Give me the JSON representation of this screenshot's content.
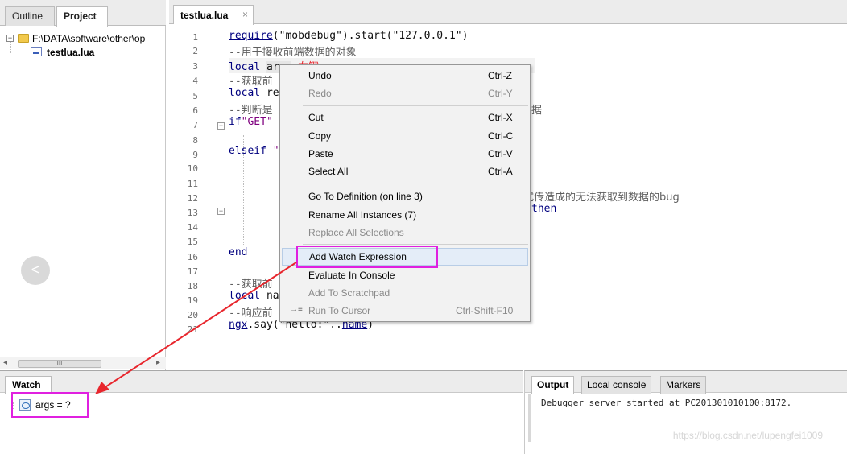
{
  "left_panel": {
    "tabs": [
      {
        "label": "Outline"
      },
      {
        "label": "Project"
      }
    ],
    "tree": {
      "root_label": "F:\\DATA\\software\\other\\op",
      "expander_glyph": "−",
      "file_label": "testlua.lua"
    },
    "scrollbar_thumb": "III"
  },
  "nav_circle_glyph": "<",
  "editor": {
    "tab_label": "testlua.lua",
    "tab_close": "×",
    "lines": {
      "1": {
        "prefix": "",
        "call": "require",
        "args": "(\"mobdebug\").start(\"127.0.0.1\")"
      },
      "2": {
        "comment": "--用于接收前端数据的对象"
      },
      "3": {
        "kw": "local",
        "word": "args",
        "rest": "=",
        "annotation": "右键"
      },
      "4": {
        "comment": "--获取前"
      },
      "5": {
        "kw": "local",
        "rest": "re"
      },
      "6": {
        "comment": "--判断是",
        "comment_tail": "据"
      },
      "7": {
        "kw": "if",
        "str": "\"GET\""
      },
      "9": {
        "kw": "elseif",
        "rest": "\""
      },
      "12": {
        "text": "式传造成的无法获取到数据的bug"
      },
      "13": {
        "kw": "then"
      },
      "16": {
        "kw": "end"
      },
      "18": {
        "comment": "--获取前"
      },
      "19": {
        "kw": "local",
        "rest": "na"
      },
      "20": {
        "comment": "--响应前"
      },
      "21": {
        "call": "ngx",
        "args": ".say(\"hello:\"..",
        "var": "name",
        "close": ")"
      }
    },
    "line_numbers": [
      "1",
      "2",
      "3",
      "4",
      "5",
      "6",
      "7",
      "8",
      "9",
      "10",
      "11",
      "12",
      "13",
      "14",
      "15",
      "16",
      "17",
      "18",
      "19",
      "20",
      "21"
    ],
    "fold_glyph": "−"
  },
  "context_menu": {
    "items": [
      {
        "label": "Undo",
        "shortcut": "Ctrl-Z",
        "enabled": true
      },
      {
        "label": "Redo",
        "shortcut": "Ctrl-Y",
        "enabled": false
      },
      {
        "label": "Cut",
        "shortcut": "Ctrl-X",
        "enabled": true
      },
      {
        "label": "Copy",
        "shortcut": "Ctrl-C",
        "enabled": true
      },
      {
        "label": "Paste",
        "shortcut": "Ctrl-V",
        "enabled": true
      },
      {
        "label": "Select All",
        "shortcut": "Ctrl-A",
        "enabled": true
      },
      {
        "label": "Go To Definition (on line 3)",
        "shortcut": "",
        "enabled": true
      },
      {
        "label": "Rename All Instances (7)",
        "shortcut": "",
        "enabled": true
      },
      {
        "label": "Replace All Selections",
        "shortcut": "",
        "enabled": false
      },
      {
        "label": "Add Watch Expression",
        "shortcut": "",
        "enabled": true
      },
      {
        "label": "Evaluate In Console",
        "shortcut": "",
        "enabled": true
      },
      {
        "label": "Add To Scratchpad",
        "shortcut": "",
        "enabled": false
      },
      {
        "label": "Run To Cursor",
        "shortcut": "Ctrl-Shift-F10",
        "enabled": false
      }
    ],
    "run_icon": "→≡"
  },
  "watch": {
    "title": "Watch",
    "entry": "args = ?"
  },
  "output": {
    "tabs": [
      {
        "label": "Output"
      },
      {
        "label": "Local console"
      },
      {
        "label": "Markers"
      }
    ],
    "text": "Debugger server started at PC201301010100:8172.",
    "watermark": "https://blog.csdn.net/lupengfei1009"
  },
  "colors": {
    "annotation_red": "#e8262d",
    "highlight_magenta": "#e020e0",
    "keyword_blue": "#00007f",
    "string_purple": "#7f007f"
  }
}
